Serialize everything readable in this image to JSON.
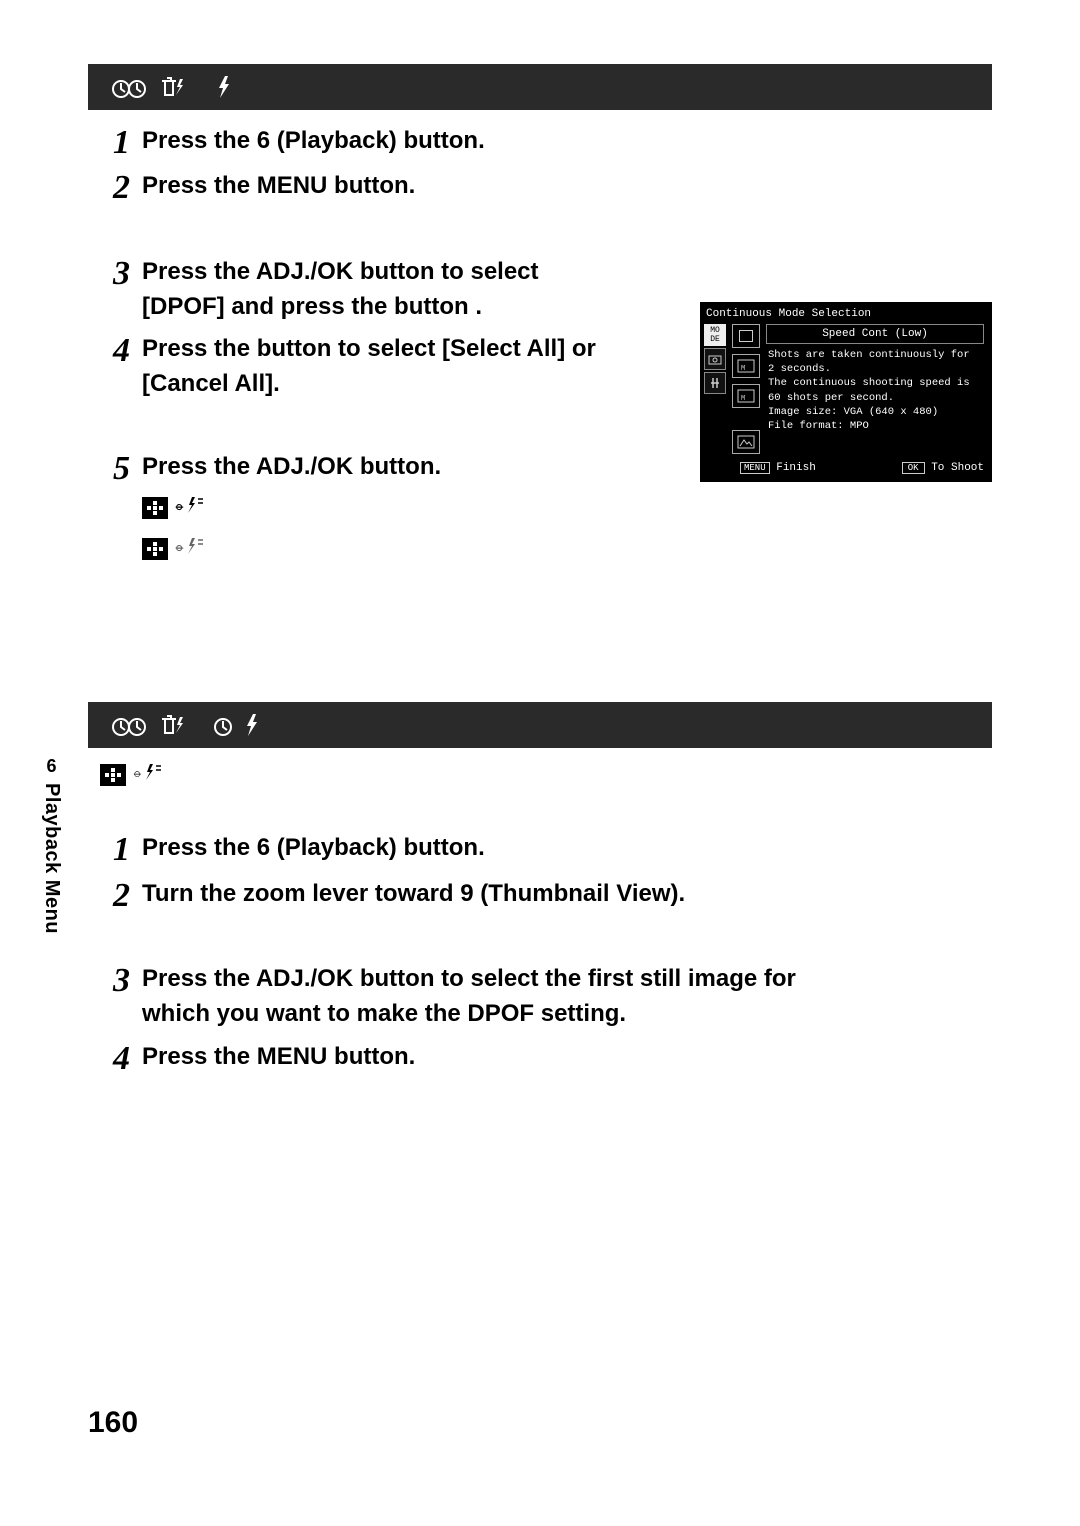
{
  "page_number": "160",
  "side": {
    "num": "6",
    "label": "Playback Menu"
  },
  "section1": {
    "steps": [
      {
        "n": "1",
        "t": "Press the 6   (Playback) button."
      },
      {
        "n": "2",
        "t": "Press the MENU button."
      },
      {
        "n": "3",
        "t": "Press the ADJ./OK button      to select [DPOF] and press the button     ."
      },
      {
        "n": "4",
        "t": "Press the button         to select [Select All] or [Cancel All]."
      },
      {
        "n": "5",
        "t": "Press the ADJ./OK button."
      }
    ]
  },
  "shot": {
    "title": "Continuous Mode Selection",
    "info_title": "Speed Cont (Low)",
    "info_lines": [
      "Shots are taken continuously for 2 seconds.",
      "The continuous shooting speed is 60 shots per second.",
      "",
      "Image size: VGA (640 x 480)",
      "File format: MPO"
    ],
    "footer_left_btn": "MENU",
    "footer_left": "Finish",
    "footer_right_btn": "OK",
    "footer_right": "To Shoot"
  },
  "section2": {
    "steps": [
      {
        "n": "1",
        "t": "Press the 6   (Playback) button."
      },
      {
        "n": "2",
        "t": "Turn the zoom lever toward 9   (Thumbnail View)."
      },
      {
        "n": "3",
        "t": "Press the ADJ./OK button             to select the first still image for which you want to make the DPOF setting."
      },
      {
        "n": "4",
        "t": "Press the MENU button."
      }
    ]
  }
}
